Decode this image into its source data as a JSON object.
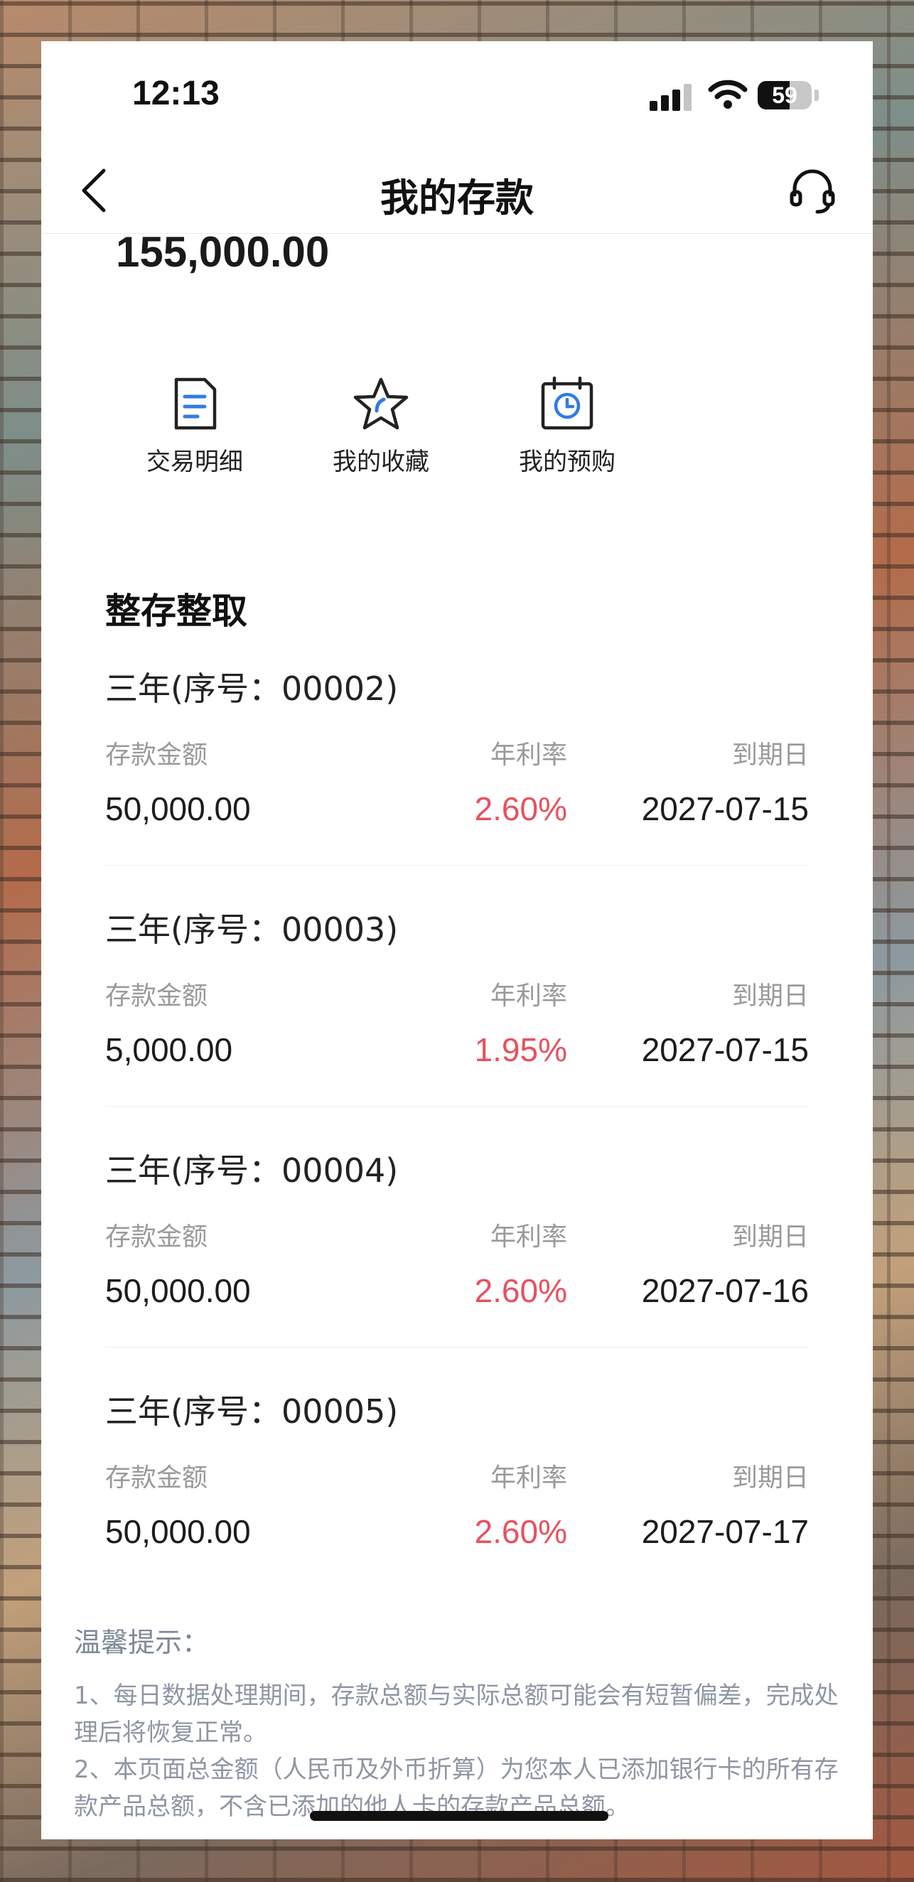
{
  "status_bar": {
    "time": "12:13",
    "battery": "59",
    "battery_level": 0.59
  },
  "nav": {
    "title": "我的存款"
  },
  "total_amount": "155,000.00",
  "actions": [
    {
      "label": "交易明细",
      "icon": "document-icon"
    },
    {
      "label": "我的收藏",
      "icon": "star-icon"
    },
    {
      "label": "我的预购",
      "icon": "calendar-clock-icon"
    }
  ],
  "section_title": "整存整取",
  "deposits": [
    {
      "title": "三年(序号：00002)",
      "amount_label": "存款金额",
      "rate_label": "年利率",
      "due_label": "到期日",
      "amount": "50,000.00",
      "rate": "2.60%",
      "due_date": "2027-07-15"
    },
    {
      "title": "三年(序号：00003)",
      "amount_label": "存款金额",
      "rate_label": "年利率",
      "due_label": "到期日",
      "amount": "5,000.00",
      "rate": "1.95%",
      "due_date": "2027-07-15"
    },
    {
      "title": "三年(序号：00004)",
      "amount_label": "存款金额",
      "rate_label": "年利率",
      "due_label": "到期日",
      "amount": "50,000.00",
      "rate": "2.60%",
      "due_date": "2027-07-16"
    },
    {
      "title": "三年(序号：00005)",
      "amount_label": "存款金额",
      "rate_label": "年利率",
      "due_label": "到期日",
      "amount": "50,000.00",
      "rate": "2.60%",
      "due_date": "2027-07-17"
    }
  ],
  "tips": {
    "title": "温馨提示：",
    "items": [
      "1、每日数据处理期间，存款总额与实际总额可能会有短暂偏差，完成处理后将恢复正常。",
      "2、本页面总金额（人民币及外币折算）为您本人已添加银行卡的所有存款产品总额，不含已添加的他人卡的存款产品总额。"
    ]
  },
  "colors": {
    "rate": "#e8505e",
    "accent_blue": "#2f7be6"
  }
}
